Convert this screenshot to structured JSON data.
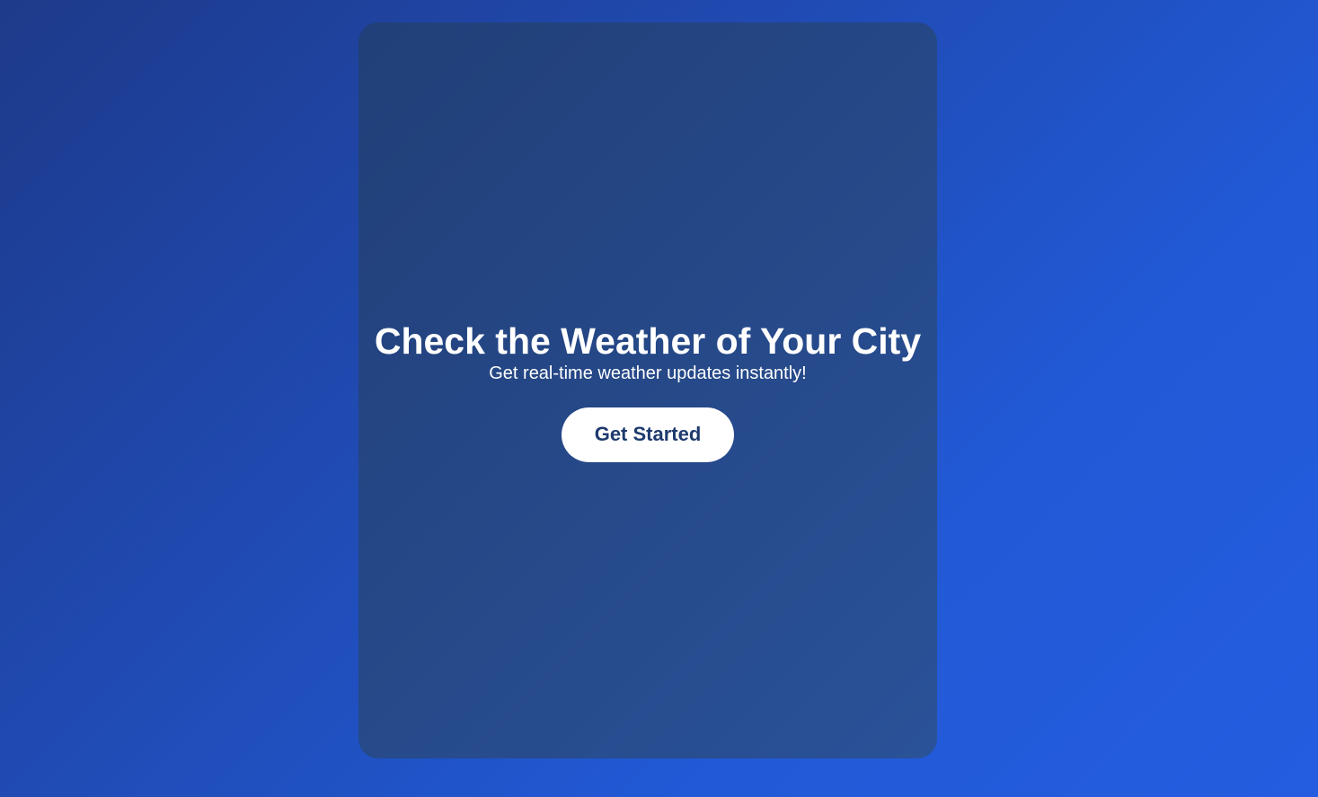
{
  "hero": {
    "title": "Check the Weather of Your City",
    "subtitle": "Get real-time weather updates instantly!",
    "cta_label": "Get Started"
  },
  "colors": {
    "accent_text": "#1e3a6e",
    "card": "#213f78",
    "background": "#1e3a8a"
  }
}
